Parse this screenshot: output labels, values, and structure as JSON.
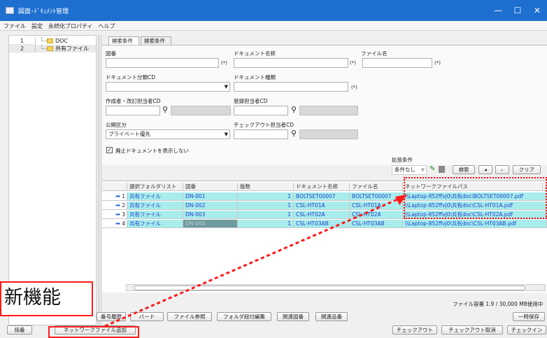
{
  "window": {
    "title": "図面･ﾄﾞｷｭﾒﾝﾄ管理",
    "minimize": "—",
    "maximize": "☐",
    "close": "✕"
  },
  "menu": [
    "ファイル",
    "設定",
    "永続化プロパティ",
    "ヘルプ"
  ],
  "tree": [
    {
      "num": "1",
      "label": "DOC"
    },
    {
      "num": "2",
      "label": "共有ファイル"
    }
  ],
  "tabs": [
    "検索条件1",
    "検索条件2"
  ],
  "form": {
    "drawing_no": {
      "label": "図番",
      "suffix": "(*)"
    },
    "doc_name": {
      "label": "ドキュメント名称",
      "suffix": "(*)"
    },
    "file_name": {
      "label": "ファイル名",
      "suffix": "(*)"
    },
    "doc_class": {
      "label": "ドキュメント分類CD"
    },
    "doc_kind": {
      "label": "ドキュメント種類",
      "suffix": "(*)"
    },
    "author": {
      "label": "作成者・改訂担当者CD"
    },
    "registrant": {
      "label": "登録担当者CD"
    },
    "visibility": {
      "label": "公開区分",
      "value": "プライベート優先"
    },
    "checkout_user": {
      "label": "チェックアウト担当者CD"
    },
    "hide_obsolete": {
      "label": "廃止ドキュメントを表示しない",
      "checked": true
    },
    "ext": {
      "label": "拡張条件",
      "value": "条件なし"
    }
  },
  "search_buttons": {
    "search": "検索",
    "prev": "◂",
    "next": "▸",
    "clear": "クリア"
  },
  "grid": {
    "headers": [
      "",
      "選択フォルダリスト",
      "図番",
      "版数",
      "ドキュメント名称",
      "ファイル名",
      "ネットワークファイルパス",
      "ｽ"
    ],
    "rows": [
      {
        "n": "1",
        "folder": "共有ファイル",
        "drawing": "DN-001",
        "rev": "1",
        "docname": "BOLTSET00007",
        "file": "BOLTSET00007",
        "path": "\\\\Laptop-852ffvj0\\共有doc\\BOLTSET00007.pdf"
      },
      {
        "n": "2",
        "folder": "共有ファイル",
        "drawing": "DN-002",
        "rev": "1",
        "docname": "CSL-HT01A",
        "file": "CSL-HT01A",
        "path": "\\\\Laptop-852ffvj0\\共有doc\\CSL-HT01A.pdf"
      },
      {
        "n": "3",
        "folder": "共有ファイル",
        "drawing": "DN-003",
        "rev": "1",
        "docname": "CSL-HT02A",
        "file": "CSL-HT02A",
        "path": "\\\\Laptop-852ffvj0\\共有doc\\CSL-HT02A.pdf"
      },
      {
        "n": "4",
        "folder": "共有ファイル",
        "drawing": "DN-004",
        "rev": "1",
        "docname": "CSL-HT03AB",
        "file": "CSL-HT03AB",
        "path": "\\\\Laptop-852ffvj0\\共有doc\\CSL-HT03AB.pdf"
      }
    ]
  },
  "capacity": "ファイル容量 1.9 / 30,000 MB使用中",
  "bottom_row1": [
    "番号履歴",
    "バード",
    "ファイル参照",
    "フォルダ紐付編集",
    "関連図番",
    "関連品番",
    "一時保存"
  ],
  "bottom_row2": [
    "採番",
    "ネットワークファイル追加",
    "チェックアウト",
    "チェックアウト取消",
    "チェックイン"
  ],
  "annotation": {
    "label": "新機能"
  },
  "colors": {
    "titlebar": "#1e6fd0",
    "row_highlight": "#a8ecec",
    "annotation": "#ff1a1a"
  }
}
